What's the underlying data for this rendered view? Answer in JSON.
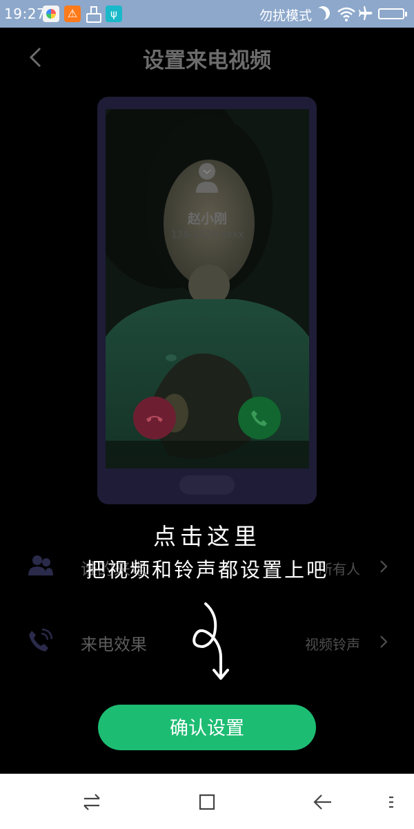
{
  "status_bar": {
    "time": "19:27",
    "dnd_label": "勿扰模式",
    "icons": [
      "app-store-icon",
      "warning-icon",
      "cleaner-icon",
      "usb-icon",
      "moon-icon",
      "wifi-icon",
      "airplane-icon",
      "battery-icon"
    ],
    "warning_glyph": "⚠",
    "usb_glyph": "ψ",
    "colors": {
      "background": "#8da8cb",
      "text": "#ffffff"
    }
  },
  "header": {
    "title": "设置来电视频",
    "back_icon": "chevron-left-icon"
  },
  "preview": {
    "caller_name": "赵小刚",
    "caller_number": "138-2520-xxxx",
    "decline_icon": "phone-hangup-icon",
    "accept_icon": "phone-answer-icon",
    "colors": {
      "decline": "#6d1f31",
      "accept": "#12662f",
      "frame": "#1e1c36"
    }
  },
  "settings": [
    {
      "label": "谁的来电",
      "value": "所有人",
      "icon": "contacts-icon"
    },
    {
      "label": "来电效果",
      "value": "视频铃声",
      "icon": "phone-ring-icon"
    }
  ],
  "hint": {
    "line1": "点击这里",
    "line2": "把视频和铃声都设置上吧"
  },
  "confirm": {
    "label": "确认设置",
    "color": "#1dbc73"
  },
  "nav_bar": {
    "icons": [
      "switch-icon",
      "home-icon",
      "back-icon",
      "menu-icon"
    ]
  }
}
